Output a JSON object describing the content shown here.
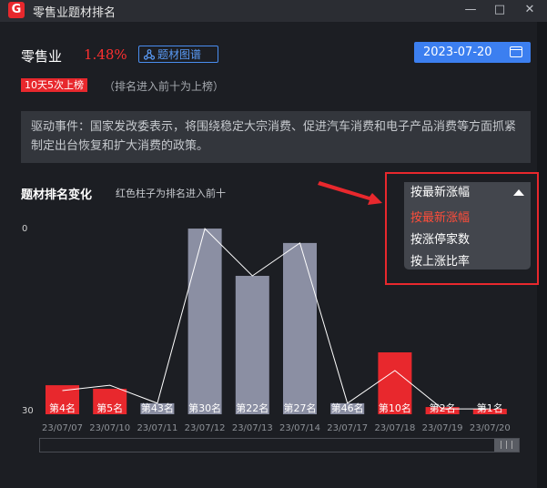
{
  "window": {
    "title": "零售业题材排名",
    "logo_letter": "G",
    "minimize": "—",
    "maximize": "□",
    "close": "✕"
  },
  "header": {
    "sector": "零售业",
    "change_pct": "1.48%",
    "map_button": "题材图谱",
    "date": "2023-07-20"
  },
  "badge": {
    "label": "10天5次上榜",
    "note": "（排名进入前十为上榜）"
  },
  "driver": {
    "text": "驱动事件：国家发改委表示，将围绕稳定大宗消费、促进汽车消费和电子产品消费等方面抓紧制定出台恢复和扩大消费的政策。"
  },
  "section": {
    "title": "题材排名变化",
    "note": "红色柱子为排名进入前十"
  },
  "sort_dropdown": {
    "selected": "按最新涨幅",
    "options": [
      "按最新涨幅",
      "按涨停家数",
      "按上涨比率"
    ]
  },
  "colors": {
    "accent_red": "#e8282d",
    "bar_gray": "#8b8fa3",
    "blue": "#3c7ff0"
  },
  "chart_data": {
    "type": "bar",
    "categories": [
      "23/07/07",
      "23/07/10",
      "23/07/11",
      "23/07/12",
      "23/07/13",
      "23/07/14",
      "23/07/17",
      "23/07/18",
      "23/07/19",
      "23/07/20"
    ],
    "values": [
      4,
      5,
      43,
      30,
      22,
      27,
      46,
      10,
      2,
      1
    ],
    "labels": [
      "第4名",
      "第5名",
      "第43名",
      "第30名",
      "第22名",
      "第27名",
      "第46名",
      "第10名",
      "第2名",
      "第1名"
    ],
    "in_top10": [
      true,
      true,
      false,
      false,
      false,
      false,
      false,
      true,
      true,
      true
    ],
    "heights_pct": [
      14.5,
      12.7,
      5.5,
      92.7,
      69.1,
      85.5,
      5.5,
      30.9,
      3.6,
      2.7
    ],
    "line_pct": [
      11.8,
      14.5,
      5.5,
      92.7,
      69.1,
      85.5,
      5.5,
      21.8,
      2.7,
      2.7
    ],
    "y_tick_labels": [
      "0",
      "30"
    ]
  },
  "scrollbar": {
    "thumb_grip": "| | |"
  }
}
